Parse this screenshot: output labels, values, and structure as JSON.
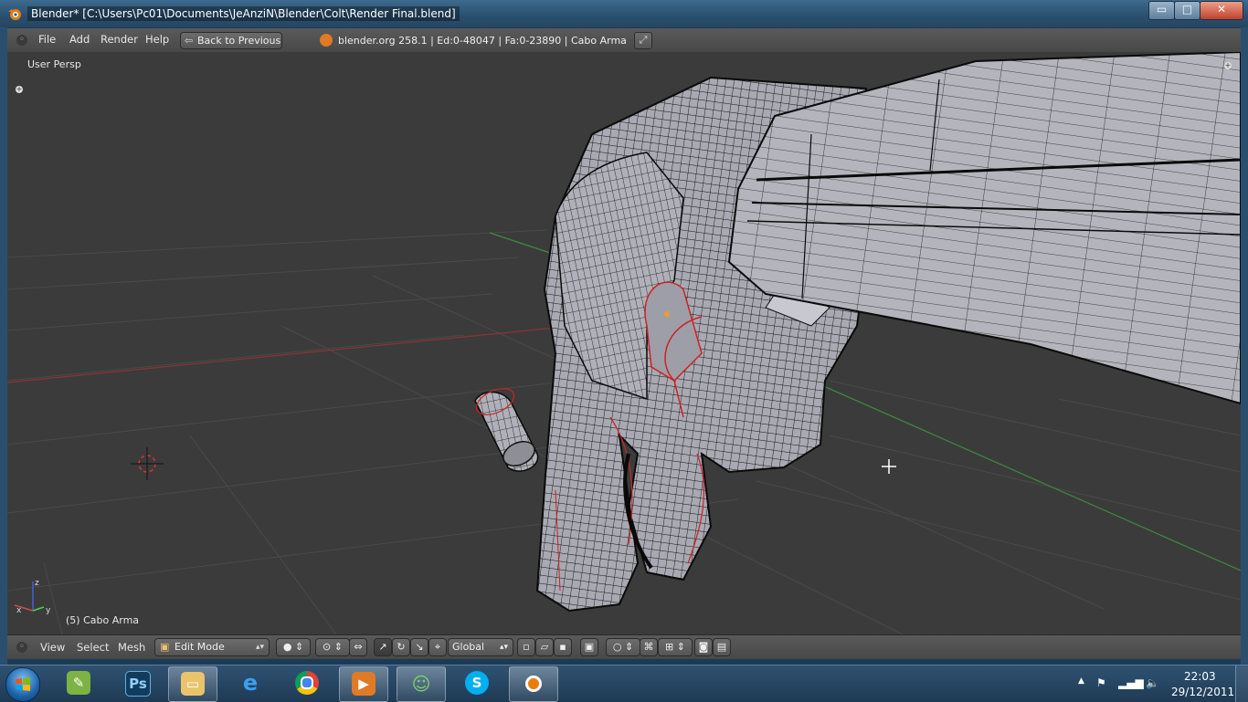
{
  "window": {
    "title": "Blender* [C:\\Users\\Pc01\\Documents\\JeAnziN\\Blender\\Colt\\Render Final.blend]",
    "minimize_glyph": "▭",
    "maximize_glyph": "□",
    "close_glyph": "✕"
  },
  "top_header": {
    "menus": [
      "File",
      "Add",
      "Render",
      "Help"
    ],
    "back_button": "Back to Previous",
    "info": "blender.org 258.1 | Ed:0-48047 | Fa:0-23890 | Cabo Arma"
  },
  "viewport": {
    "view_label": "User Persp",
    "object_label": "(5) Cabo Arma",
    "axis_x": "x",
    "axis_y": "y",
    "axis_z": "z",
    "colors": {
      "background": "#3b3b3b",
      "grid": "#4a4a4a",
      "x_axis": "#9a3a3a",
      "y_axis": "#3f8a3f",
      "mesh": "#a9a9b3",
      "wire": "#101010",
      "seam": "#cc2222"
    }
  },
  "bottom_header": {
    "menus": [
      "View",
      "Select",
      "Mesh"
    ],
    "mode": "Edit Mode",
    "orientation": "Global"
  },
  "taskbar": {
    "apps": [
      "start-menu",
      "coreldraw",
      "photoshop",
      "explorer",
      "internet-explorer",
      "chrome",
      "media-player",
      "messenger",
      "skype",
      "blender"
    ],
    "photoshop_glyph": "Ps",
    "clock_time": "22:03",
    "clock_date": "29/12/2011"
  }
}
